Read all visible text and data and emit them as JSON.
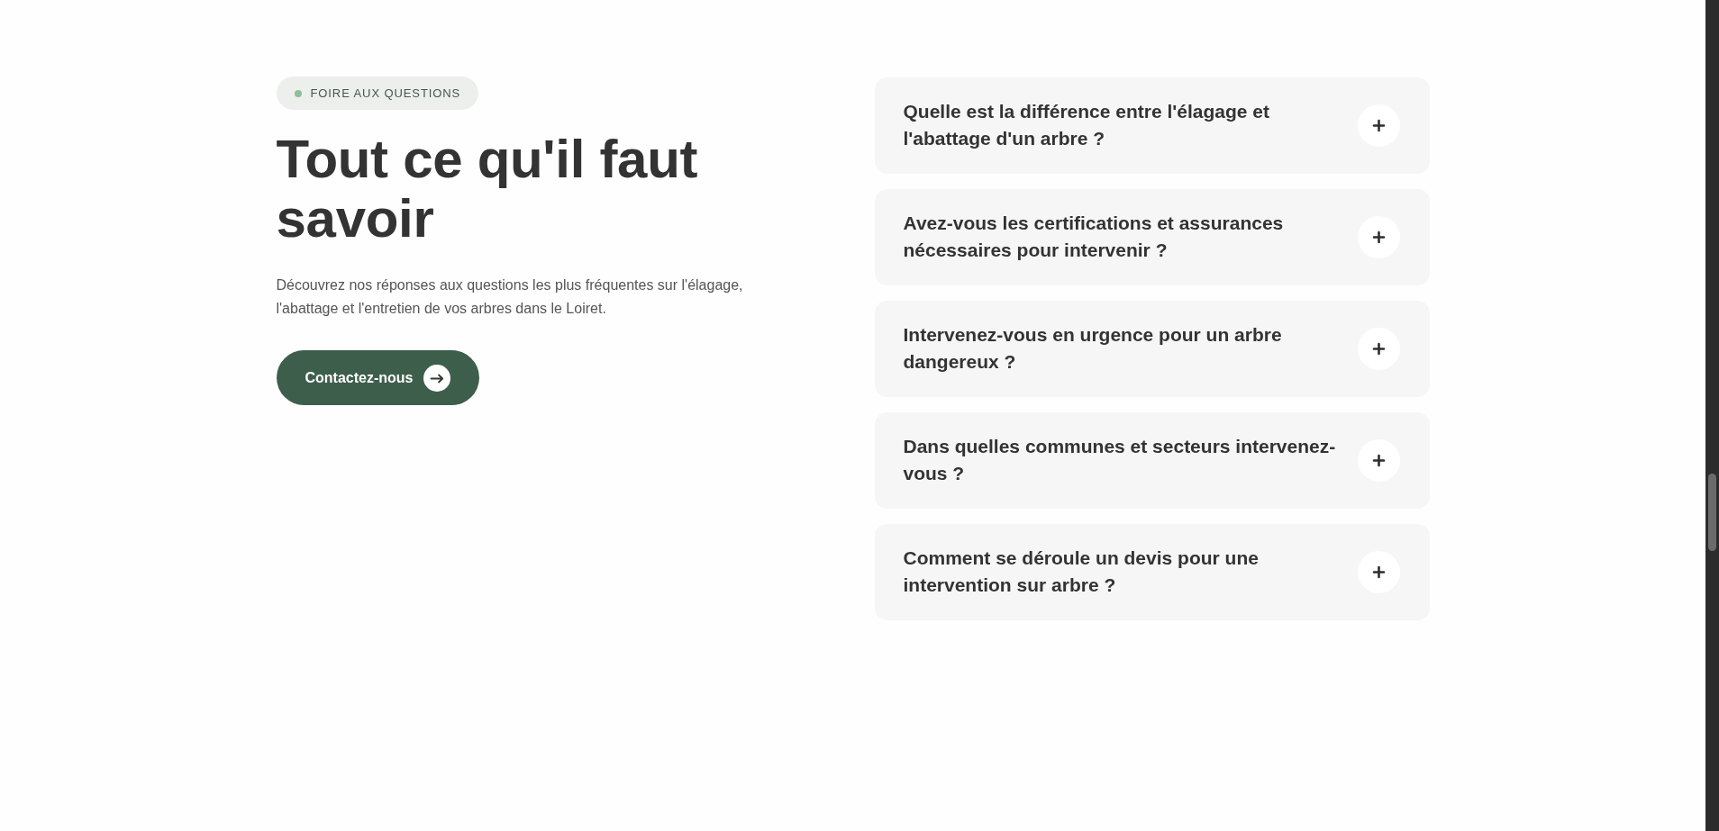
{
  "badge": {
    "label": "FOIRE AUX QUESTIONS"
  },
  "heading": "Tout ce qu'il faut savoir",
  "intro": "Découvrez nos réponses aux questions les plus fréquentes sur l'élagage, l'abattage et l'entretien de vos arbres dans le Loiret.",
  "cta": {
    "label": "Contactez-nous"
  },
  "faq": [
    {
      "question": "Quelle est la différence entre l'élagage et l'abattage d'un arbre ?",
      "expanded": false
    },
    {
      "question": "Avez-vous les certifications et assurances nécessaires pour intervenir ?",
      "expanded": false
    },
    {
      "question": "Intervenez-vous en urgence pour un arbre dangereux ?",
      "expanded": false
    },
    {
      "question": "Dans quelles communes et secteurs intervenez-vous ?",
      "expanded": false
    },
    {
      "question": "Comment se déroule un devis pour une intervention sur arbre ?",
      "expanded": false
    }
  ]
}
